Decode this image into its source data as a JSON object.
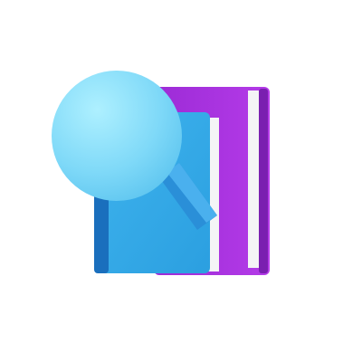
{
  "icon": {
    "name": "book-search-icon",
    "colors": {
      "purple_book": "#9c2bd6",
      "purple_book_light": "#b43be8",
      "purple_book_spine": "#7a1fb0",
      "page_white": "#f4f4f6",
      "blue_book": "#2b9fe0",
      "blue_book_light": "#3fb4ee",
      "blue_book_spine": "#1a6fbd",
      "lens_light": "#aef0ff",
      "lens_mid": "#7fd9f8",
      "lens_dark": "#5cc4ef",
      "handle": "#2a8fd8"
    }
  }
}
